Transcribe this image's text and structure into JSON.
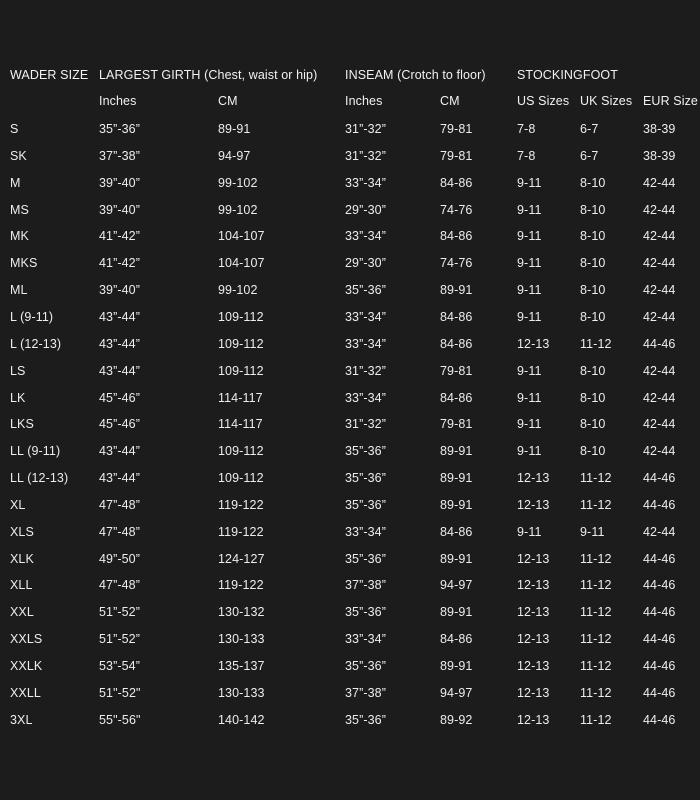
{
  "header": {
    "wader_size": "WADER SIZE",
    "largest_girth": "LARGEST GIRTH  (Chest, waist or hip)",
    "inseam": "INSEAM  (Crotch to floor)",
    "stockingfoot": "STOCKINGFOOT"
  },
  "subheader": {
    "girth_inches": "Inches",
    "girth_cm": "CM",
    "inseam_inches": "Inches",
    "inseam_cm": "CM",
    "us_sizes": "US Sizes",
    "uk_sizes": "UK Sizes",
    "eur_size": "EUR Size"
  },
  "rows": [
    [
      "S",
      "35”-36”",
      "89-91",
      "31”-32”",
      "79-81",
      "7-8",
      "6-7",
      "38-39"
    ],
    [
      "SK",
      "37”-38”",
      "94-97",
      "31”-32”",
      "79-81",
      "7-8",
      "6-7",
      "38-39"
    ],
    [
      "M",
      "39”-40”",
      "99-102",
      "33”-34”",
      "84-86",
      "9-11",
      "8-10",
      "42-44"
    ],
    [
      "MS",
      "39”-40”",
      "99-102",
      "29”-30”",
      "74-76",
      "9-11",
      "8-10",
      "42-44"
    ],
    [
      "MK",
      "41”-42”",
      "104-107",
      "33”-34”",
      "84-86",
      "9-11",
      "8-10",
      "42-44"
    ],
    [
      "MKS",
      "41”-42”",
      "104-107",
      "29”-30”",
      "74-76",
      "9-11",
      "8-10",
      "42-44"
    ],
    [
      "ML",
      "39”-40”",
      "99-102",
      "35”-36”",
      "89-91",
      "9-11",
      "8-10",
      "42-44"
    ],
    [
      "L (9-11)",
      "43”-44”",
      "109-112",
      "33”-34”",
      "84-86",
      "9-11",
      "8-10",
      "42-44"
    ],
    [
      "L (12-13)",
      "43”-44”",
      "109-112",
      "33”-34”",
      "84-86",
      "12-13",
      "11-12",
      "44-46"
    ],
    [
      "LS",
      "43”-44”",
      "109-112",
      "31”-32”",
      "79-81",
      "9-11",
      "8-10",
      "42-44"
    ],
    [
      "LK",
      "45”-46”",
      "114-117",
      "33”-34”",
      "84-86",
      "9-11",
      "8-10",
      "42-44"
    ],
    [
      "LKS",
      "45”-46”",
      "114-117",
      "31”-32”",
      "79-81",
      "9-11",
      "8-10",
      "42-44"
    ],
    [
      "LL (9-11)",
      "43”-44”",
      "109-112",
      "35”-36”",
      "89-91",
      "9-11",
      "8-10",
      "42-44"
    ],
    [
      "LL (12-13)",
      "43”-44”",
      "109-112",
      "35”-36”",
      "89-91",
      "12-13",
      "11-12",
      "44-46"
    ],
    [
      "XL",
      "47”-48”",
      "119-122",
      "35”-36”",
      "89-91",
      "12-13",
      "11-12",
      "44-46"
    ],
    [
      "XLS",
      "47”-48”",
      "119-122",
      "33”-34”",
      "84-86",
      "9-11",
      "9-11",
      "42-44"
    ],
    [
      "XLK",
      "49”-50”",
      "124-127",
      "35”-36”",
      "89-91",
      "12-13",
      "11-12",
      "44-46"
    ],
    [
      "XLL",
      "47”-48”",
      "119-122",
      "37”-38”",
      "94-97",
      "12-13",
      "11-12",
      "44-46"
    ],
    [
      "XXL",
      "51”-52”",
      "130-132",
      "35”-36”",
      "89-91",
      "12-13",
      "11-12",
      "44-46"
    ],
    [
      "XXLS",
      "51”-52”",
      "130-133",
      "33”-34”",
      "84-86",
      "12-13",
      "11-12",
      "44-46"
    ],
    [
      "XXLK",
      "53”-54”",
      "135-137",
      "35”-36”",
      "89-91",
      "12-13",
      "11-12",
      "44-46"
    ],
    [
      "XXLL",
      "51\"-52\"",
      "130-133",
      "37”-38”",
      "94-97",
      "12-13",
      "11-12",
      "44-46"
    ],
    [
      "3XL",
      "55\"-56\"",
      "140-142",
      "35”-36”",
      "89-92",
      "12-13",
      "11-12",
      "44-46"
    ]
  ]
}
